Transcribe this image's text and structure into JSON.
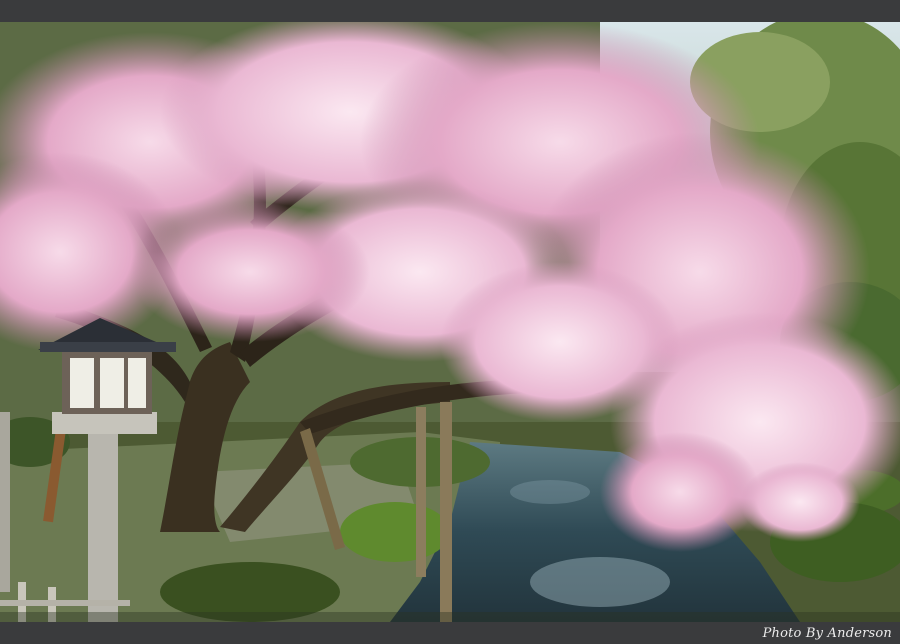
{
  "photo": {
    "credit_text": "Photo By Anderson",
    "frame_color": "#3a3b3d",
    "blossom_color": "#e6b3cf",
    "water_color": "#2f4a55"
  }
}
